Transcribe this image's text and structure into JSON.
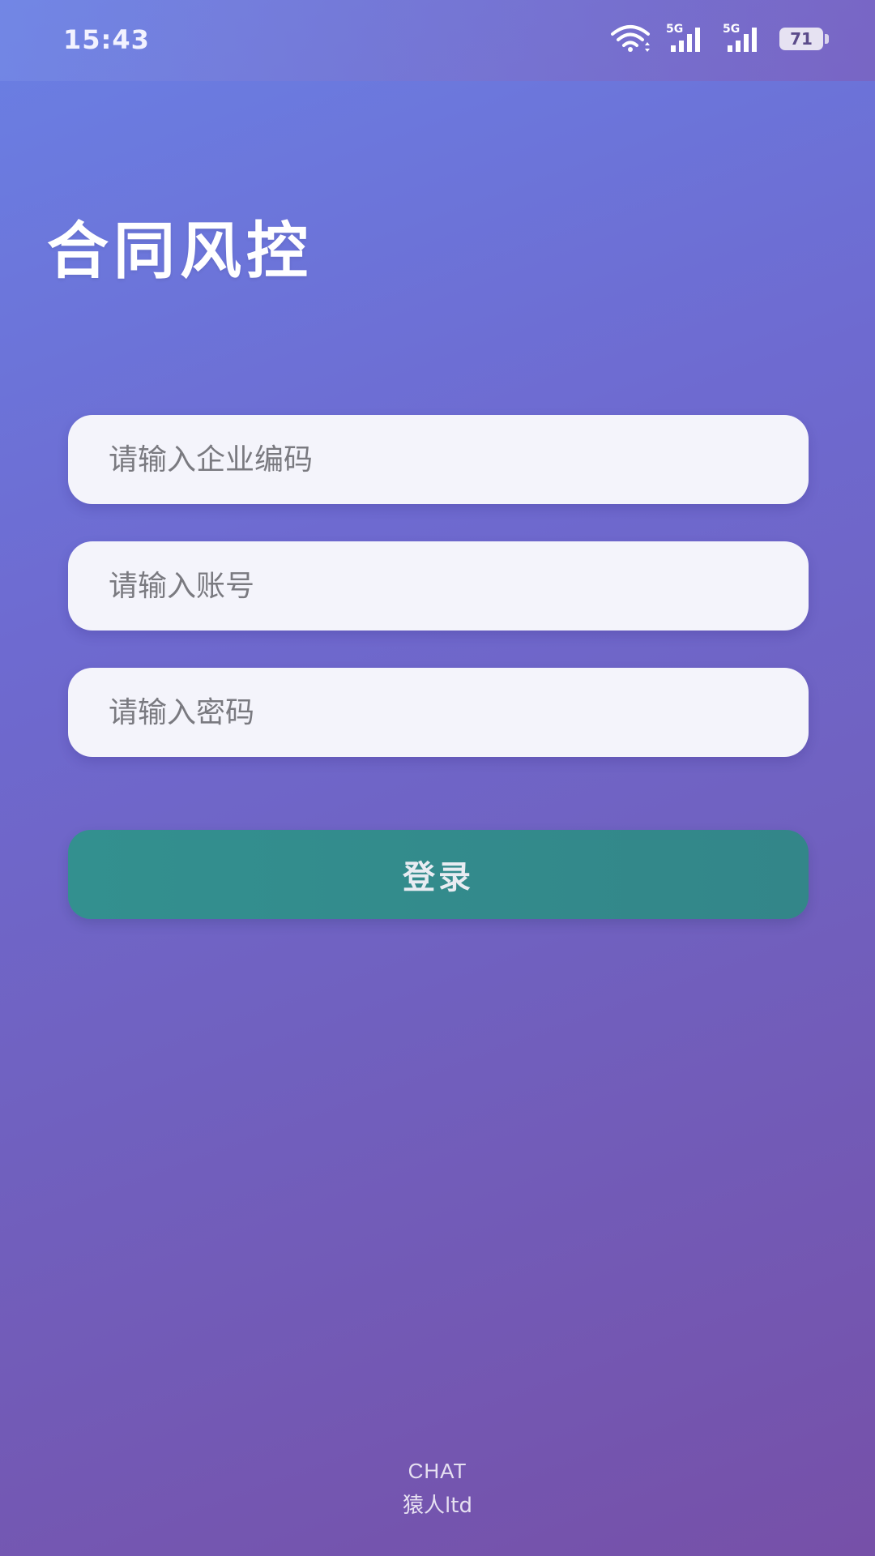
{
  "status_bar": {
    "time": "15:43",
    "signal1_label": "5G",
    "signal2_label": "5G",
    "battery_level": "71"
  },
  "app": {
    "title": "合同风控"
  },
  "form": {
    "company_code_placeholder": "请输入企业编码",
    "account_placeholder": "请输入账号",
    "password_placeholder": "请输入密码",
    "login_label": "登录"
  },
  "footer": {
    "line1": "CHAT",
    "line2": "猿人ltd"
  },
  "colors": {
    "login_button": "#33908f",
    "input_background": "#f4f4fb"
  }
}
